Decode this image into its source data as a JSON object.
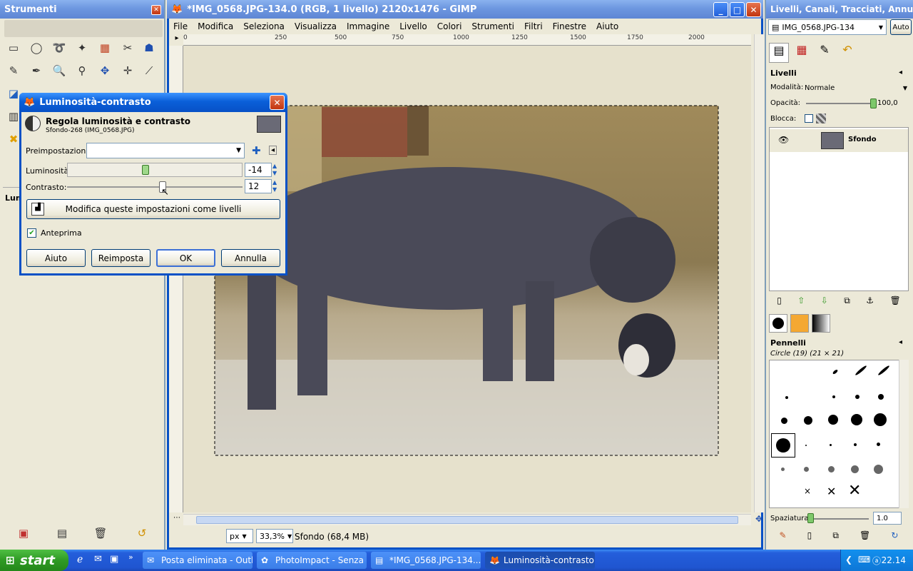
{
  "toolbox": {
    "title": "Strumenti",
    "lum_label": "Lum"
  },
  "main_window": {
    "title": "*IMG_0568.JPG-134.0 (RGB, 1 livello) 2120x1476 - GIMP",
    "menus": [
      "File",
      "Modifica",
      "Seleziona",
      "Visualizza",
      "Immagine",
      "Livello",
      "Colori",
      "Strumenti",
      "Filtri",
      "Finestre",
      "Aiuto"
    ],
    "ruler_ticks": [
      "0",
      "250",
      "500",
      "750",
      "1000",
      "1250",
      "1500",
      "1750",
      "2000"
    ],
    "unit": "px",
    "zoom": "33,3%",
    "status": "Sfondo (68,4 MB)"
  },
  "dialog": {
    "title": "Luminosità-contrasto",
    "heading": "Regola luminosità e contrasto",
    "subheading": "Sfondo-268 (IMG_0568.JPG)",
    "presets_label": "Preimpostazioni:",
    "brightness_label": "Luminosità:",
    "brightness_value": "-14",
    "brightness_level": -14,
    "contrast_label": "Contrasto:",
    "contrast_value": "12",
    "contrast_level": 12,
    "edit_as_levels": "Modifica queste impostazioni come livelli",
    "preview_label": "Anteprima",
    "preview_checked": true,
    "buttons": {
      "help": "Aiuto",
      "reset": "Reimposta",
      "ok": "OK",
      "cancel": "Annulla"
    }
  },
  "dock": {
    "title": "Livelli, Canali, Tracciati, Annulla ...",
    "image_select": "IMG_0568.JPG-134",
    "auto_label": "Auto",
    "layers_title": "Livelli",
    "mode_label": "Modalità:",
    "mode_value": "Normale",
    "opacity_label": "Opacità:",
    "opacity_value": "100,0",
    "lock_label": "Blocca:",
    "layer_name": "Sfondo",
    "brushes_title": "Pennelli",
    "brush_info": "Circle (19) (21 × 21)",
    "spacing_label": "Spaziatura:",
    "spacing_value": "1.0"
  },
  "taskbar": {
    "start": "start",
    "tasks": [
      "Posta eliminata - Outl...",
      "PhotoImpact - Senza ...",
      "*IMG_0568.JPG-134....",
      "Luminosità-contrasto"
    ],
    "clock": "22.14"
  },
  "colors": {
    "xp_blue": "#0751c6",
    "start_green": "#2f9a24",
    "sky": "#8ab4d8"
  }
}
